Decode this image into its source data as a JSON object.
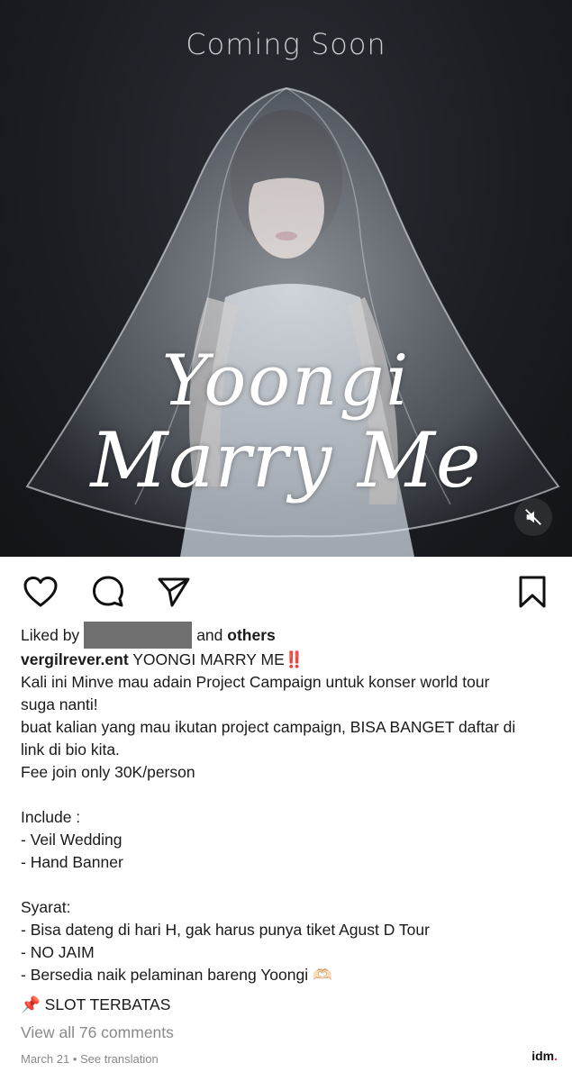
{
  "media": {
    "overlay_top": "Coming Soon",
    "script_line1": "Yoongi",
    "script_line2": "Marry Me",
    "mute_icon": "speaker-muted-icon"
  },
  "actions": {
    "like_icon": "heart-icon",
    "comment_icon": "comment-icon",
    "share_icon": "send-icon",
    "save_icon": "bookmark-icon"
  },
  "likes": {
    "prefix": "Liked by",
    "connector": "and",
    "others": "others"
  },
  "caption": {
    "username": "vergilrever.ent",
    "headline": " YOONGI MARRY ME‼️",
    "lines": [
      "Kali ini Minve mau adain Project Campaign untuk konser world tour",
      "suga nanti!",
      "buat kalian yang mau ikutan project campaign, BISA BANGET daftar di",
      "link di bio kita.",
      "Fee join only 30K/person",
      "",
      "Include :",
      "- Veil Wedding",
      "- Hand Banner",
      "",
      "Syarat:",
      "- Bisa dateng di hari H, gak harus punya tiket Agust D Tour",
      "- NO JAIM",
      "- Bersedia naik pelaminan bareng Yoongi 🫶🏻"
    ],
    "slot": "📌 SLOT TERBATAS"
  },
  "comments_link": "View all 76 comments",
  "date": "March 21",
  "separator": " • ",
  "see_translation": "See translation",
  "watermark": {
    "text": "idm",
    "dot": "."
  },
  "colors": {
    "accent_dot": "#e03b3b",
    "muted_text": "#8a8a8a",
    "redaction": "#6f6f6f"
  }
}
